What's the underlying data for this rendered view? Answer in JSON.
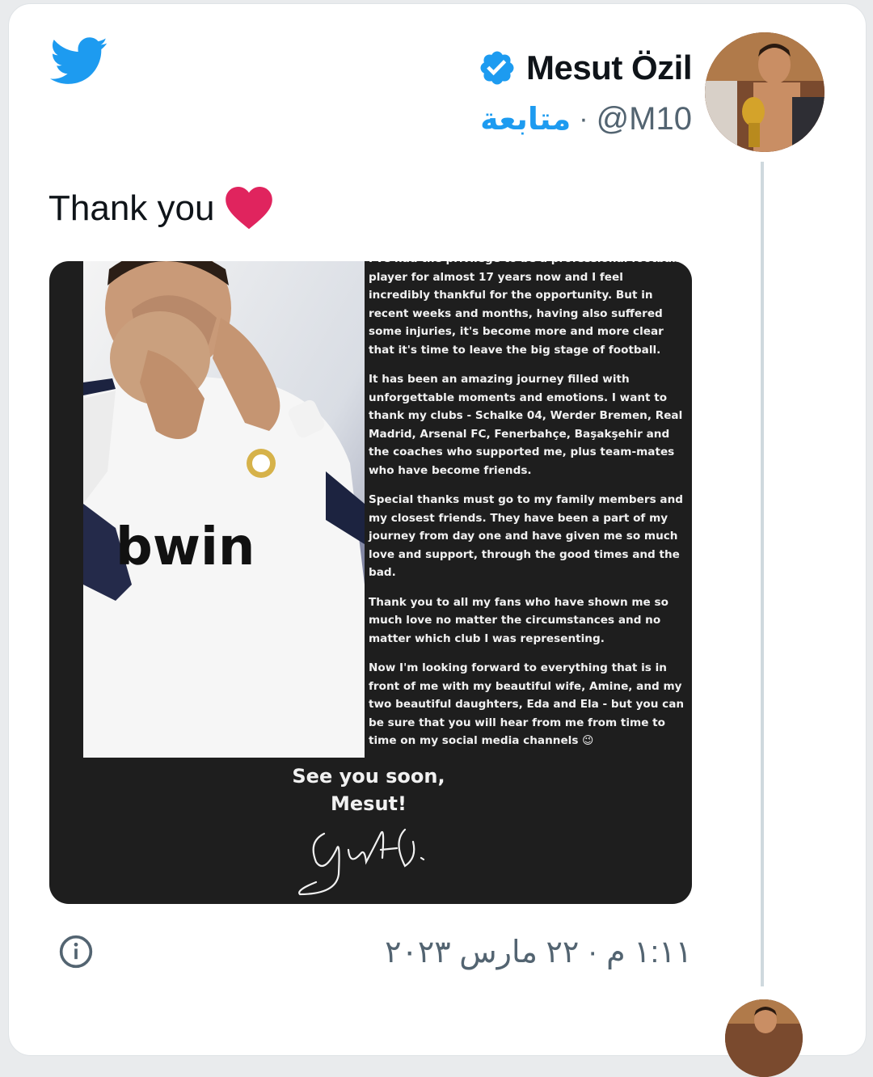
{
  "tweet": {
    "author_name": "Mesut Özil",
    "handle": "@M10",
    "separator": "·",
    "follow_label": "متابعة",
    "text": "Thank you",
    "timestamp": "١:١١ م · ٢٢ مارس ٢٠٢٣"
  },
  "media": {
    "letter_paragraphs": [
      "I've had the privilege to be a professional football player for almost 17 years now and I feel incredibly thankful for the opportunity. But in recent weeks and months, having also suffered some injuries, it's become more and more clear that it's time to leave the big stage of football.",
      "It has been an amazing journey filled with unforgettable moments and emotions. I want to thank my clubs - Schalke 04, Werder Bremen, Real Madrid, Arsenal FC, Fenerbahçe, Başakşehir and the coaches who supported me, plus team-mates who have become friends.",
      "Special thanks must go to my family members and my closest friends. They have been a part of my journey from day one and have given me so much love and support, through the good times and the bad.",
      "Thank you to all my fans who have shown me so much love no matter the circumstances and no matter which club I was representing.",
      "Now I'm looking forward to everything that is in front of me with my beautiful wife, Amine, and my two beautiful daughters, Eda and Ela - but you can be sure that you will hear from me from time to time on my social media channels 😉"
    ],
    "signoff_line1": "See you soon,",
    "signoff_line2": "Mesut!",
    "shirt_sponsor": "bwin"
  },
  "colors": {
    "twitter_blue": "#1d9bf0",
    "heart_red": "#e0245e",
    "text_primary": "#0f1419",
    "text_secondary": "#536471"
  }
}
